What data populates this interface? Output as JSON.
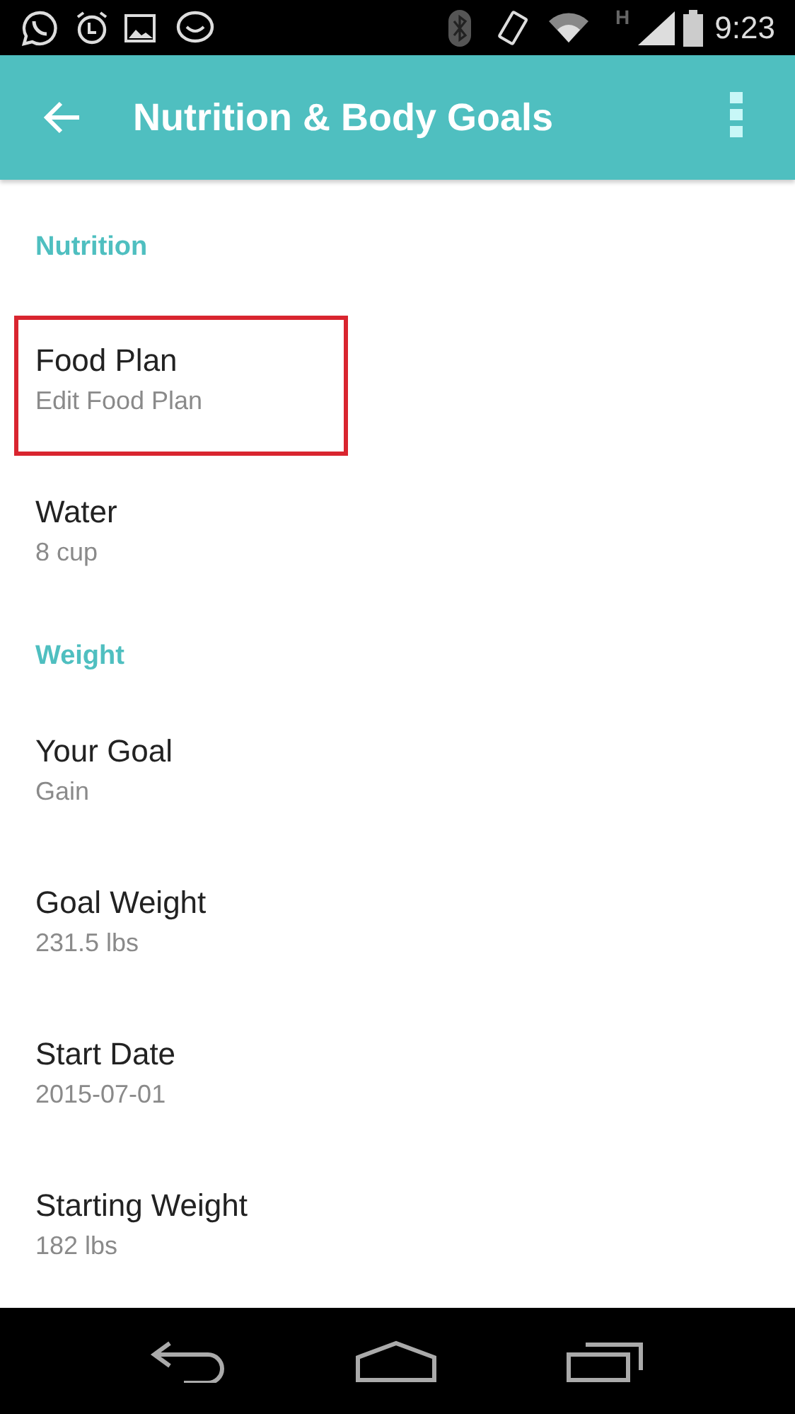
{
  "status_bar": {
    "time": "9:23",
    "network_type": "H"
  },
  "app_bar": {
    "title": "Nutrition & Body Goals"
  },
  "sections": [
    {
      "title": "Nutrition",
      "items": [
        {
          "title": "Food Plan",
          "subtitle": "Edit Food Plan",
          "highlighted": true
        },
        {
          "title": "Water",
          "subtitle": "8 cup",
          "highlighted": false
        }
      ]
    },
    {
      "title": "Weight",
      "items": [
        {
          "title": "Your Goal",
          "subtitle": "Gain",
          "highlighted": false
        },
        {
          "title": "Goal Weight",
          "subtitle": "231.5 lbs",
          "highlighted": false
        },
        {
          "title": "Start Date",
          "subtitle": "2015-07-01",
          "highlighted": false
        },
        {
          "title": "Starting Weight",
          "subtitle": "182 lbs",
          "highlighted": false
        }
      ]
    }
  ]
}
